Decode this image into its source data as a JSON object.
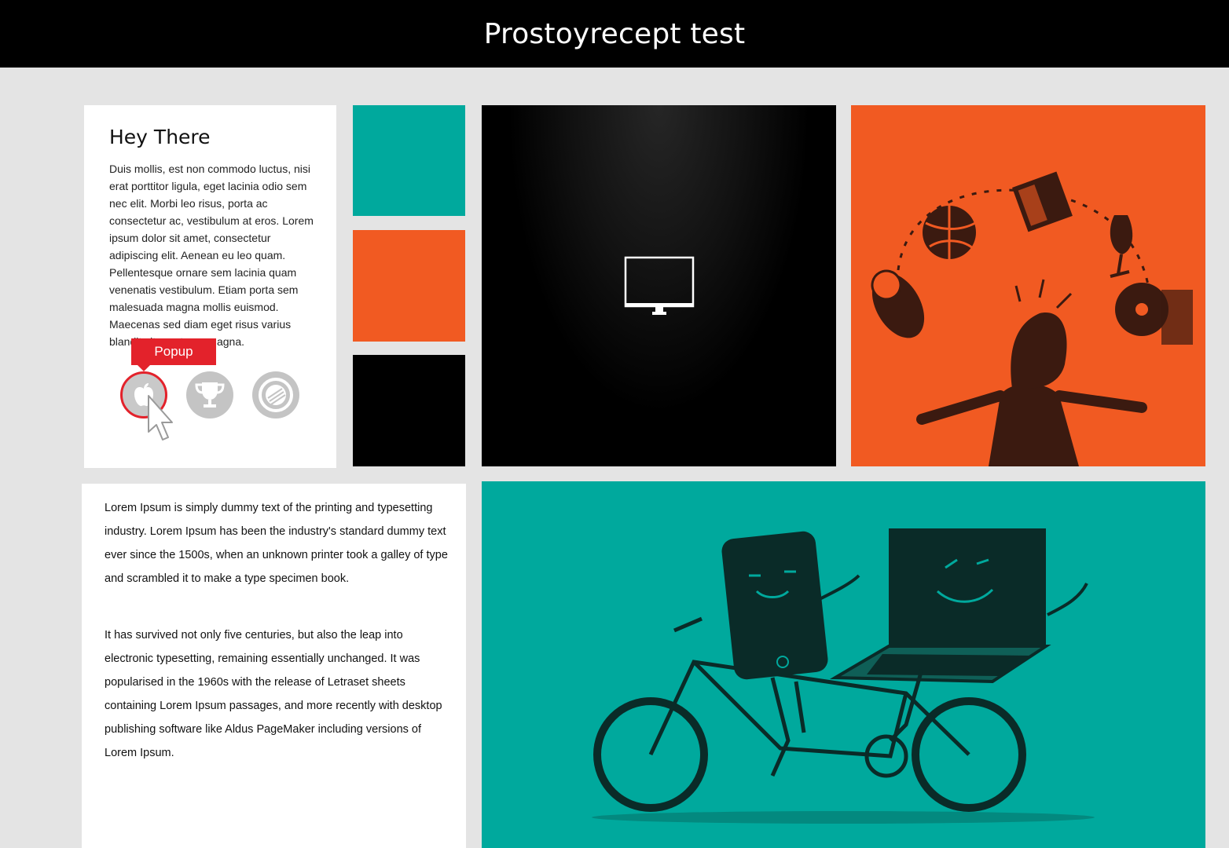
{
  "header": {
    "title": "Prostoyrecept test"
  },
  "intro_card": {
    "heading": "Hey There",
    "body": "Duis mollis, est non commodo luctus, nisi erat porttitor ligula, eget lacinia odio sem nec elit. Morbi leo risus, porta ac consectetur ac, vestibulum at eros. Lorem ipsum dolor sit amet, consectetur adipiscing elit. Aenean eu leo quam. Pellentesque ornare sem lacinia quam venenatis vestibulum. Etiam porta sem malesuada magna mollis euismod. Maecenas sed diam eget risus varius blandit sit amet non magna.",
    "popup_label": "Popup",
    "icons": [
      "apple-icon",
      "trophy-icon",
      "record-icon"
    ]
  },
  "color_tiles": [
    {
      "name": "teal",
      "color": "#00a99d"
    },
    {
      "name": "orange",
      "color": "#f15a22"
    },
    {
      "name": "black",
      "color": "#000000"
    }
  ],
  "hero": {
    "icon": "monitor-icon"
  },
  "text_card": {
    "paragraph1": "Lorem Ipsum is simply dummy text of the printing and typesetting industry. Lorem Ipsum has been the industry's standard dummy text ever since the 1500s, when an unknown printer took a galley of type and scrambled it to make a type specimen book.",
    "paragraph2": "It has survived not only five centuries, but also the leap into electronic typesetting, remaining essentially unchanged. It was popularised in the 1960s with the release of Letraset sheets containing Lorem Ipsum passages, and more recently with desktop publishing software like Aldus PageMaker including versions of Lorem Ipsum."
  },
  "colors": {
    "accent_red": "#e3222b",
    "teal": "#00a99d",
    "orange": "#f15a22",
    "dark": "#1a1a1a"
  }
}
